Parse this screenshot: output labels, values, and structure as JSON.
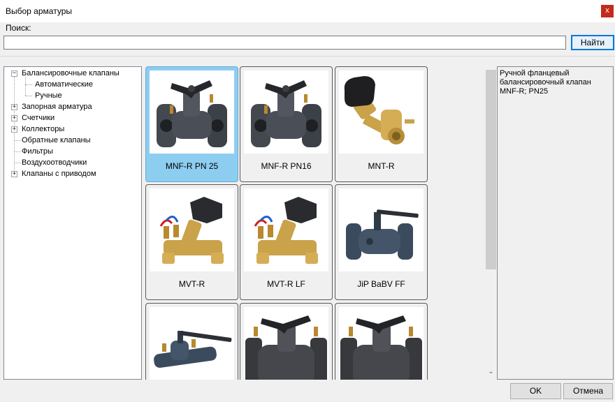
{
  "window": {
    "title": "Выбор арматуры",
    "close_label": "x"
  },
  "search": {
    "label": "Поиск:",
    "value": "",
    "placeholder": "",
    "find_label": "Найти"
  },
  "tree": {
    "items": [
      {
        "label": "Балансировочные клапаны",
        "expander": "−",
        "level": 0
      },
      {
        "label": "Автоматические",
        "expander": "",
        "level": 1
      },
      {
        "label": "Ручные",
        "expander": "",
        "level": 1
      },
      {
        "label": "Запорная арматура",
        "expander": "+",
        "level": 0
      },
      {
        "label": "Счетчики",
        "expander": "+",
        "level": 0
      },
      {
        "label": "Коллекторы",
        "expander": "+",
        "level": 0
      },
      {
        "label": "Обратные клапаны",
        "expander": "",
        "level": 0
      },
      {
        "label": "Фильтры",
        "expander": "",
        "level": 0
      },
      {
        "label": "Воздухоотводчики",
        "expander": "",
        "level": 0
      },
      {
        "label": "Клапаны с приводом",
        "expander": "+",
        "level": 0
      }
    ]
  },
  "products": [
    {
      "label": "MNF-R PN 25",
      "icon": "flanged-balancing-valve-icon",
      "selected": true
    },
    {
      "label": "MNF-R PN16",
      "icon": "flanged-balancing-valve-icon",
      "selected": false
    },
    {
      "label": "MNT-R",
      "icon": "brass-threaded-valve-icon",
      "selected": false
    },
    {
      "label": "MVT-R",
      "icon": "brass-balancing-valve-icon",
      "selected": false
    },
    {
      "label": "MVT-R LF",
      "icon": "brass-balancing-valve-icon",
      "selected": false
    },
    {
      "label": "JiP BaBV FF",
      "icon": "ball-valve-flanged-icon",
      "selected": false
    },
    {
      "label": "",
      "icon": "welded-ball-valve-icon",
      "selected": false
    },
    {
      "label": "",
      "icon": "large-flanged-valve-icon",
      "selected": false
    },
    {
      "label": "",
      "icon": "large-flanged-valve-icon",
      "selected": false
    }
  ],
  "description": {
    "text": "Ручной фланцевый балансировочный клапан MNF-R; PN25"
  },
  "buttons": {
    "ok_label": "OK",
    "cancel_label": "Отмена"
  },
  "colors": {
    "selection": "#8dcdf0",
    "close_button": "#c42b1c",
    "accent": "#0078d7"
  }
}
